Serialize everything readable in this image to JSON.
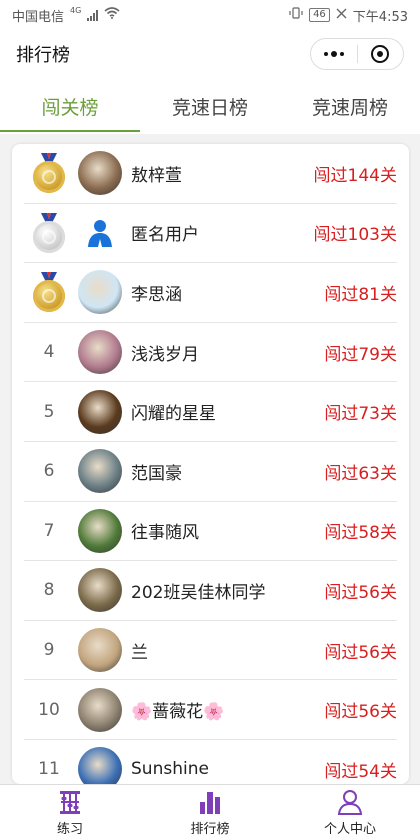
{
  "status_bar": {
    "carrier": "中国电信",
    "network": "4G",
    "battery": "46",
    "time": "下午4:53"
  },
  "title_bar": {
    "title": "排行榜",
    "more_icon": "more-dots-icon",
    "close_icon": "target-icon"
  },
  "tabs": [
    {
      "label": "闯关榜",
      "active": true
    },
    {
      "label": "竞速日榜",
      "active": false
    },
    {
      "label": "竞速周榜",
      "active": false
    }
  ],
  "leaderboard": [
    {
      "rank": "1",
      "medal": "gold",
      "name": "敖梓萱",
      "score": "闯过144关",
      "avatar_color": "#8a6b4f"
    },
    {
      "rank": "2",
      "medal": "silver",
      "name": "匿名用户",
      "score": "闯过103关",
      "avatar_color": "#ffffff"
    },
    {
      "rank": "3",
      "medal": "gold",
      "name": "李思涵",
      "score": "闯过81关",
      "avatar_color": "#cfe6f5"
    },
    {
      "rank": "4",
      "medal": "",
      "name": "浅浅岁月",
      "score": "闯过79关",
      "avatar_color": "#b07a8e"
    },
    {
      "rank": "5",
      "medal": "",
      "name": "闪耀的星星",
      "score": "闯过73关",
      "avatar_color": "#5a3a1e"
    },
    {
      "rank": "6",
      "medal": "",
      "name": "范国豪",
      "score": "闯过63关",
      "avatar_color": "#6b7f86"
    },
    {
      "rank": "7",
      "medal": "",
      "name": "往事随风",
      "score": "闯过58关",
      "avatar_color": "#4f7a38"
    },
    {
      "rank": "8",
      "medal": "",
      "name": "202班吴佳林同学",
      "score": "闯过56关",
      "avatar_color": "#7a6a4a"
    },
    {
      "rank": "9",
      "medal": "",
      "name": "兰",
      "score": "闯过56关",
      "avatar_color": "#c2a57f"
    },
    {
      "rank": "10",
      "medal": "",
      "name": "🌸蔷薇花🌸",
      "score": "闯过56关",
      "avatar_color": "#8d8170"
    },
    {
      "rank": "11",
      "medal": "",
      "name": "Sunshine",
      "score": "闯过54关",
      "avatar_color": "#3b6fb5"
    }
  ],
  "bottom_nav": [
    {
      "label": "练习",
      "icon": "abacus-icon",
      "active": false
    },
    {
      "label": "排行榜",
      "icon": "bar-chart-icon",
      "active": true
    },
    {
      "label": "个人中心",
      "icon": "person-icon",
      "active": false
    }
  ],
  "colors": {
    "accent": "#6b9f3a",
    "score": "#d81e1e",
    "nav_icon": "#7e3fb8"
  }
}
